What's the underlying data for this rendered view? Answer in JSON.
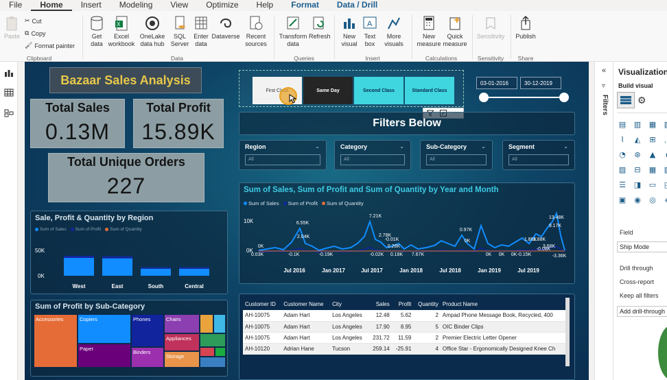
{
  "menu": [
    "File",
    "Home",
    "Insert",
    "Modeling",
    "View",
    "Optimize",
    "Help",
    "Format",
    "Data / Drill"
  ],
  "ribbon": {
    "paste": "Paste",
    "cut": "Cut",
    "copy": "Copy",
    "format_painter": "Format painter",
    "get_data": "Get\ndata",
    "excel": "Excel\nworkbook",
    "onelake": "OneLake\ndata hub",
    "sql": "SQL\nServer",
    "enter": "Enter\ndata",
    "dataverse": "Dataverse",
    "recent": "Recent\nsources",
    "transform": "Transform\ndata",
    "refresh": "Refresh",
    "new_visual": "New\nvisual",
    "text_box": "Text\nbox",
    "more_visuals": "More\nvisuals",
    "new_measure": "New\nmeasure",
    "quick_measure": "Quick\nmeasure",
    "sensitivity": "Sensitivity",
    "publish": "Publish",
    "groups": {
      "clipboard": "Clipboard",
      "data": "Data",
      "queries": "Queries",
      "insert": "Insert",
      "calculations": "Calculations",
      "sensitivity": "Sensitivity",
      "share": "Share"
    }
  },
  "dashboard": {
    "title": "Bazaar Sales Analysis",
    "kpis": [
      {
        "label": "Total Sales",
        "value": "0.13M"
      },
      {
        "label": "Total Profit",
        "value": "15.89K"
      },
      {
        "label": "Total Unique Orders",
        "value": "227"
      }
    ],
    "ship_modes": [
      "First Class",
      "Same Day",
      "Second Class",
      "Standard Class"
    ],
    "date_from": "03-01-2016",
    "date_to": "30-12-2019",
    "filters_title": "Filters Below",
    "dropdowns": [
      {
        "label": "Region",
        "value": "All"
      },
      {
        "label": "Category",
        "value": "All"
      },
      {
        "label": "Sub-Category",
        "value": "All"
      },
      {
        "label": "Segment",
        "value": "All"
      }
    ],
    "colors": {
      "accent": "#3ecbe4",
      "title": "#e8c74a",
      "sales": "#118dff",
      "profit": "#12239e",
      "quantity": "#e66c37"
    }
  },
  "chart_data": [
    {
      "type": "line",
      "title": "Sum of Sales, Sum of Profit and Sum of Quantity by Year and Month",
      "series": [
        {
          "name": "Sum of Sales"
        },
        {
          "name": "Sum of Profit"
        },
        {
          "name": "Sum of Quantity"
        }
      ],
      "y_ticks": [
        "10K",
        "0K"
      ],
      "x_ticks": [
        "Jul 2016",
        "Jan 2017",
        "Jul 2017",
        "Jan 2018",
        "Jul 2018",
        "Jan 2019",
        "Jul 2019"
      ],
      "data_labels": [
        "0K",
        "0.03K",
        "6.55K",
        "2.04K",
        "-0.1K",
        "-0.19K",
        "7.21K",
        "2.78K",
        "-0.01K",
        "0.28K",
        "-0.02K",
        "0.18K",
        "7.67K",
        "0.97K",
        "0K",
        "0K",
        "0K",
        "0K",
        "-0.15K",
        "1.86K",
        "1.88K",
        "3.68K",
        "9.17K",
        "13.48K",
        "-0.08K",
        "-3.36K"
      ]
    },
    {
      "type": "bar",
      "title": "Sale, Profit & Quantity by Region",
      "series": [
        {
          "name": "Sum of Sales"
        },
        {
          "name": "Sum of Profit"
        },
        {
          "name": "Sum of Quantity"
        }
      ],
      "categories": [
        "West",
        "East",
        "South",
        "Central"
      ],
      "values": [
        38000,
        37000,
        16000,
        16000
      ],
      "y_ticks": [
        "50K",
        "0K"
      ]
    },
    {
      "type": "treemap",
      "title": "Sum of Profit by Sub-Category",
      "categories": [
        "Accessories",
        "Copiers",
        "Phones",
        "Chairs",
        "Appliances",
        "Paper",
        "Binders",
        "Storage"
      ]
    }
  ],
  "table": {
    "headers": [
      "Customer ID",
      "Customer Name",
      "City",
      "Sales",
      "Profit",
      "Quantity",
      "Product Name"
    ],
    "rows": [
      [
        "AH-10075",
        "Adam Hart",
        "Los Angeles",
        "12.48",
        "5.62",
        "2",
        "Ampad Phone Message Book, Recycled, 400"
      ],
      [
        "AH-10075",
        "Adam Hart",
        "Los Angeles",
        "17.90",
        "8.95",
        "5",
        "OIC Binder Clips"
      ],
      [
        "AH-10075",
        "Adam Hart",
        "Los Angeles",
        "231.72",
        "11.59",
        "2",
        "Premier Electric Letter Opener"
      ],
      [
        "AH-10120",
        "Adrian Hane",
        "Tucson",
        "259.14",
        "-25.91",
        "4",
        "Office Star - Ergonomically Designed Knee Ch"
      ]
    ]
  },
  "right_pane": {
    "title": "Visualizations",
    "build": "Build visual",
    "filters": "Filters",
    "field": "Field",
    "field_value": "Ship Mode",
    "drill_through": "Drill through",
    "cross_report": "Cross-report",
    "keep_filters": "Keep all filters",
    "add_drill": "Add drill-through"
  }
}
